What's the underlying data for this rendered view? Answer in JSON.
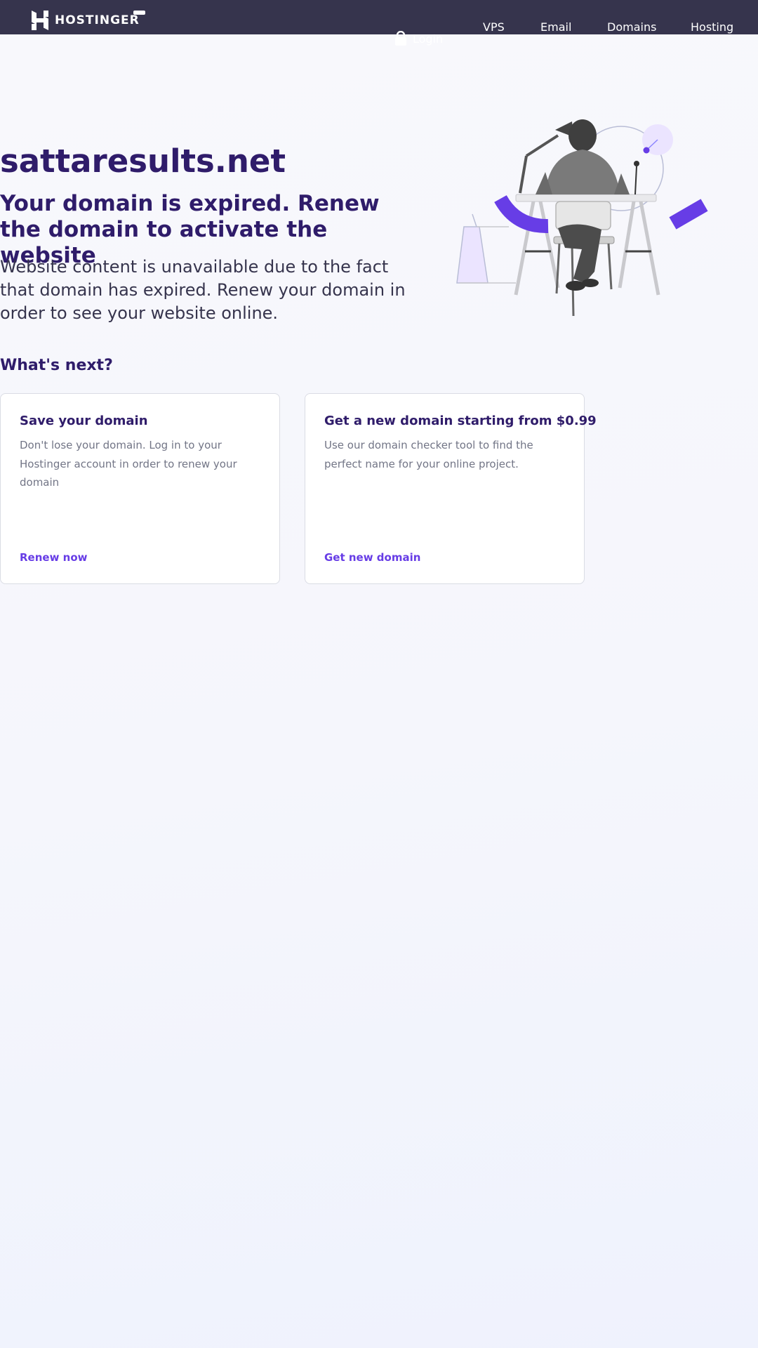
{
  "header": {
    "brand": "HOSTINGER",
    "nav": [
      {
        "label": "VPS"
      },
      {
        "label": "Email"
      },
      {
        "label": "Domains"
      },
      {
        "label": "Hosting"
      }
    ],
    "login_label": "Login",
    "icons": {
      "logo": "hostinger-h-logo",
      "login": "lock-icon"
    }
  },
  "hero": {
    "domain": "sattaresults.net",
    "headline": "Your domain is expired. Renew the domain to activate the website",
    "lede": "Website content is unavailable due to the fact that domain has expired. Renew your domain in order to see your website online.",
    "illustration": "person-at-desk-illustration"
  },
  "next": {
    "title": "What's next?",
    "cards": [
      {
        "title": "Save your domain",
        "text": "Don't lose your domain. Log in to your Hostinger account in order to renew your domain",
        "link": "Renew now"
      },
      {
        "title": "Get a new domain starting from $0.99",
        "text": "Use our domain checker tool to find the perfect name for your online project.",
        "link": "Get new domain"
      }
    ]
  },
  "colors": {
    "header_bg": "#36344d",
    "heading": "#2f1c6a",
    "accent": "#673de6",
    "body_text": "#36344d",
    "muted_text": "#727586",
    "card_border": "#dadce4"
  }
}
